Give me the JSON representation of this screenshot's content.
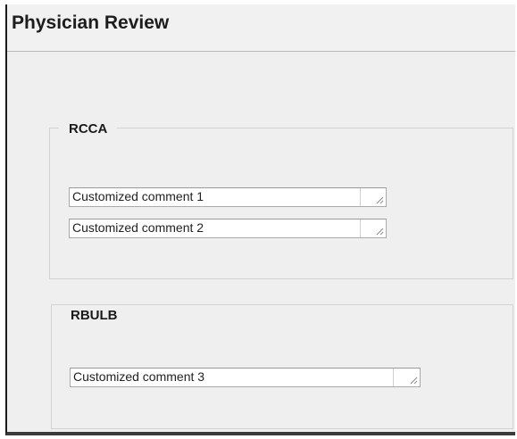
{
  "panel": {
    "title": "Physician Review"
  },
  "groups": [
    {
      "legend": "RCCA",
      "comments": [
        {
          "value": "Customized comment 1"
        },
        {
          "value": "Customized comment 2"
        }
      ]
    },
    {
      "legend": "RBULB",
      "comments": [
        {
          "value": "Customized comment 3"
        }
      ]
    }
  ],
  "icons": {
    "resize": "resize-grip-icon"
  },
  "colors": {
    "panel_background": "#efefef",
    "group_border": "#d3d3d3",
    "field_background": "#ffffff",
    "field_border": "#aaaaaa",
    "title_text": "#1d1d1d"
  }
}
